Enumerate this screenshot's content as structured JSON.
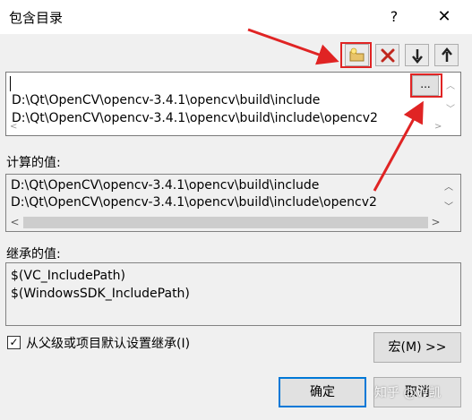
{
  "window": {
    "title": "包含目录",
    "help_glyph": "?",
    "close_glyph": "✕"
  },
  "toolbar": {
    "new_line_icon": "new-folder-icon",
    "delete_icon": "delete-x-icon",
    "move_down_icon": "arrow-down-icon",
    "move_up_icon": "arrow-up-icon"
  },
  "editor": {
    "lines": [
      "",
      "D:\\Qt\\OpenCV\\opencv-3.4.1\\opencv\\build\\include",
      "D:\\Qt\\OpenCV\\opencv-3.4.1\\opencv\\build\\include\\opencv2"
    ],
    "ellipsis_label": "..."
  },
  "evaluated": {
    "label": "计算的值:",
    "lines": [
      "D:\\Qt\\OpenCV\\opencv-3.4.1\\opencv\\build\\include",
      "D:\\Qt\\OpenCV\\opencv-3.4.1\\opencv\\build\\include\\opencv2"
    ]
  },
  "inherited": {
    "label": "继承的值:",
    "lines": [
      "$(VC_IncludePath)",
      "$(WindowsSDK_IncludePath)"
    ]
  },
  "inherit_checkbox": {
    "label": "从父级或项目默认设置继承(I)",
    "checked": true
  },
  "buttons": {
    "macro": "宏(M) >>",
    "ok": "确定",
    "cancel": "取消"
  },
  "watermark": "知乎 @W凯",
  "colors": {
    "annotation": "#e02424",
    "dialog_bg": "#f0f0f0",
    "focus": "#0078d7"
  }
}
